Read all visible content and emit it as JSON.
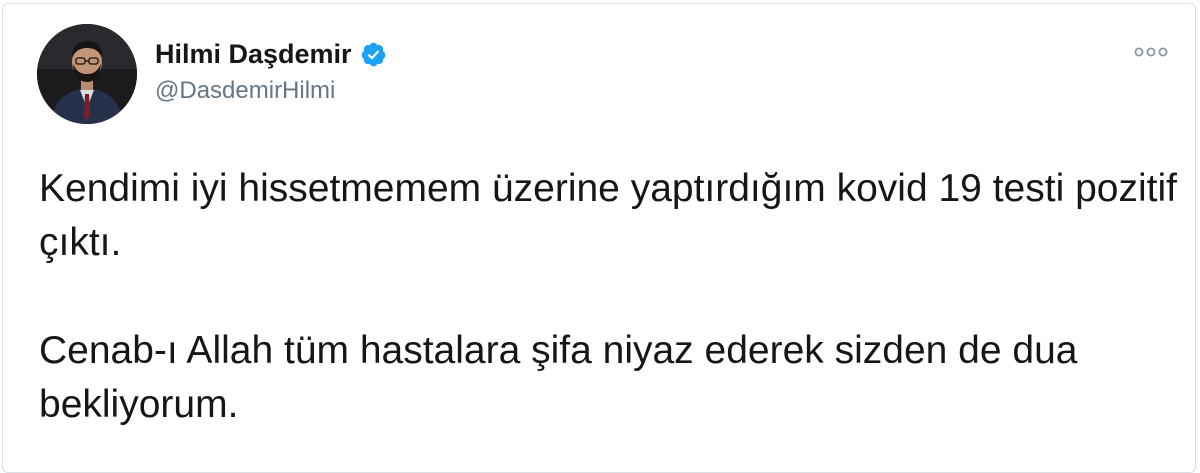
{
  "tweet": {
    "author": {
      "display_name": "Hilmi Daşdemir",
      "handle": "@DasdemirHilmi",
      "verified": true,
      "avatar_icon": "person-photo-avatar"
    },
    "more_icon": "more-options-icon",
    "body": {
      "paragraph_1": "Kendimi iyi hissetmemem üzerine yaptırdığım kovid 19 testi pozitif çıktı.",
      "paragraph_2": "Cenab-ı Allah tüm hastalara şifa niyaz ederek sizden de dua bekliyorum."
    }
  },
  "colors": {
    "text_primary": "#14171a",
    "text_secondary": "#657786",
    "verified_blue": "#1da1f2",
    "border": "#d9dfe3"
  }
}
